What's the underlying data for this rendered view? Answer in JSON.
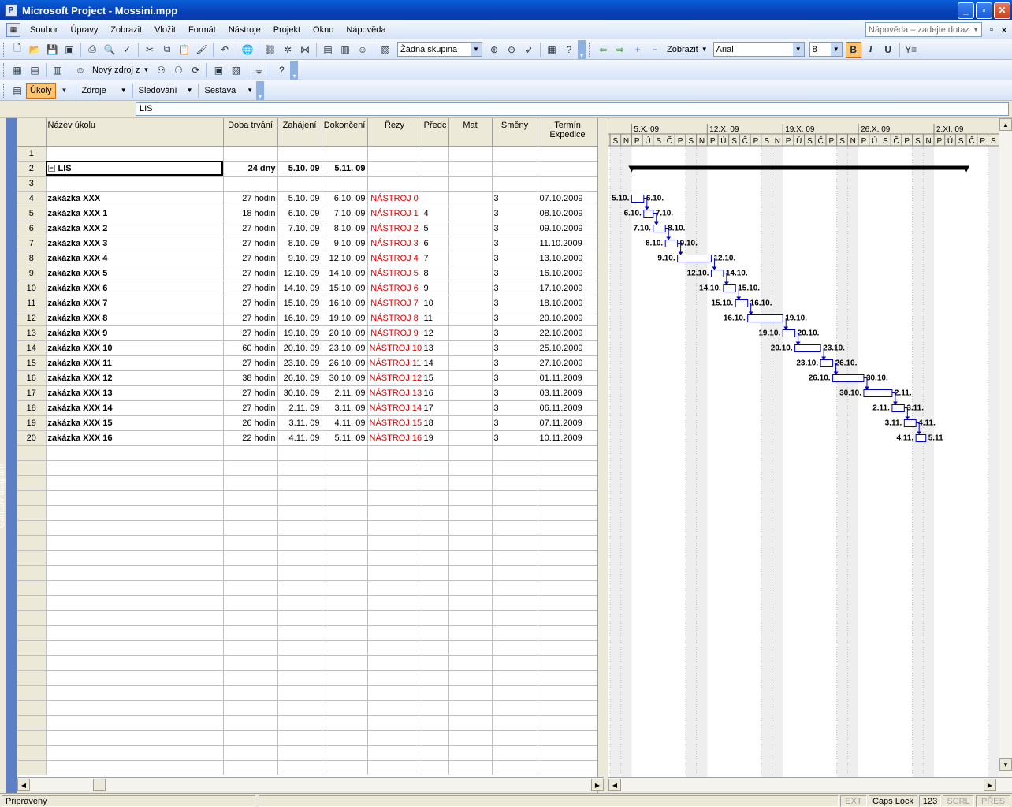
{
  "window": {
    "title": "Microsoft Project - Mossini.mpp",
    "app_icon": "ms-project-icon"
  },
  "menu": {
    "items": [
      "Soubor",
      "Úpravy",
      "Zobrazit",
      "Vložit",
      "Formát",
      "Nástroje",
      "Projekt",
      "Okno",
      "Nápověda"
    ],
    "help_placeholder": "Nápověda – zadejte dotaz"
  },
  "toolbar1": {
    "group_combo": "Žádná skupina",
    "show_label": "Zobrazit",
    "font_combo": "Arial",
    "size_combo": "8",
    "bold": "B",
    "italic": "I",
    "underline": "U"
  },
  "toolbar2": {
    "new_resource_label": "Nový zdroj z"
  },
  "toolbar3": {
    "items": [
      "Úkoly",
      "Zdroje",
      "Sledování",
      "Sestava"
    ],
    "active": "Úkoly"
  },
  "entry_bar": {
    "value": "LIS"
  },
  "side_label": "Ganttův diagram",
  "table": {
    "columns": [
      "Název úkolu",
      "Doba trvání",
      "Zahájení",
      "Dokončení",
      "Řezy",
      "Předc",
      "Mat",
      "Směny",
      "Termín Expedice"
    ],
    "rows": [
      {
        "id": "1",
        "name": "",
        "duration": "",
        "start": "",
        "finish": "",
        "rezy": "",
        "pred": "",
        "mat": "",
        "smeny": "",
        "termin": ""
      },
      {
        "id": "2",
        "name": "LIS",
        "duration": "24 dny",
        "start": "5.10. 09",
        "finish": "5.11. 09",
        "rezy": "",
        "pred": "",
        "mat": "",
        "smeny": "",
        "termin": ""
      },
      {
        "id": "3",
        "name": "",
        "duration": "",
        "start": "",
        "finish": "",
        "rezy": "",
        "pred": "",
        "mat": "",
        "smeny": "",
        "termin": ""
      },
      {
        "id": "4",
        "name": "zakázka XXX",
        "duration": "27 hodin",
        "start": "5.10. 09",
        "finish": "6.10. 09",
        "rezy": "NÁSTROJ 0",
        "pred": "",
        "mat": "",
        "smeny": "3",
        "termin": "07.10.2009"
      },
      {
        "id": "5",
        "name": "zakázka XXX 1",
        "duration": "18 hodin",
        "start": "6.10. 09",
        "finish": "7.10. 09",
        "rezy": "NÁSTROJ 1",
        "pred": "4",
        "mat": "",
        "smeny": "3",
        "termin": "08.10.2009"
      },
      {
        "id": "6",
        "name": "zakázka XXX 2",
        "duration": "27 hodin",
        "start": "7.10. 09",
        "finish": "8.10. 09",
        "rezy": "NÁSTROJ 2",
        "pred": "5",
        "mat": "",
        "smeny": "3",
        "termin": "09.10.2009"
      },
      {
        "id": "7",
        "name": "zakázka XXX 3",
        "duration": "27 hodin",
        "start": "8.10. 09",
        "finish": "9.10. 09",
        "rezy": "NÁSTROJ 3",
        "pred": "6",
        "mat": "",
        "smeny": "3",
        "termin": "11.10.2009"
      },
      {
        "id": "8",
        "name": "zakázka XXX 4",
        "duration": "27 hodin",
        "start": "9.10. 09",
        "finish": "12.10. 09",
        "rezy": "NÁSTROJ 4",
        "pred": "7",
        "mat": "",
        "smeny": "3",
        "termin": "13.10.2009"
      },
      {
        "id": "9",
        "name": "zakázka XXX 5",
        "duration": "27 hodin",
        "start": "12.10. 09",
        "finish": "14.10. 09",
        "rezy": "NÁSTROJ 5",
        "pred": "8",
        "mat": "",
        "smeny": "3",
        "termin": "16.10.2009"
      },
      {
        "id": "10",
        "name": "zakázka XXX 6",
        "duration": "27 hodin",
        "start": "14.10. 09",
        "finish": "15.10. 09",
        "rezy": "NÁSTROJ 6",
        "pred": "9",
        "mat": "",
        "smeny": "3",
        "termin": "17.10.2009"
      },
      {
        "id": "11",
        "name": "zakázka XXX 7",
        "duration": "27 hodin",
        "start": "15.10. 09",
        "finish": "16.10. 09",
        "rezy": "NÁSTROJ 7",
        "pred": "10",
        "mat": "",
        "smeny": "3",
        "termin": "18.10.2009"
      },
      {
        "id": "12",
        "name": "zakázka XXX 8",
        "duration": "27 hodin",
        "start": "16.10. 09",
        "finish": "19.10. 09",
        "rezy": "NÁSTROJ 8",
        "pred": "11",
        "mat": "",
        "smeny": "3",
        "termin": "20.10.2009"
      },
      {
        "id": "13",
        "name": "zakázka XXX 9",
        "duration": "27 hodin",
        "start": "19.10. 09",
        "finish": "20.10. 09",
        "rezy": "NÁSTROJ 9",
        "pred": "12",
        "mat": "",
        "smeny": "3",
        "termin": "22.10.2009"
      },
      {
        "id": "14",
        "name": "zakázka XXX 10",
        "duration": "60 hodin",
        "start": "20.10. 09",
        "finish": "23.10. 09",
        "rezy": "NÁSTROJ 10",
        "pred": "13",
        "mat": "",
        "smeny": "3",
        "termin": "25.10.2009"
      },
      {
        "id": "15",
        "name": "zakázka XXX 11",
        "duration": "27 hodin",
        "start": "23.10. 09",
        "finish": "26.10. 09",
        "rezy": "NÁSTROJ 11",
        "pred": "14",
        "mat": "",
        "smeny": "3",
        "termin": "27.10.2009"
      },
      {
        "id": "16",
        "name": "zakázka XXX 12",
        "duration": "38 hodin",
        "start": "26.10. 09",
        "finish": "30.10. 09",
        "rezy": "NÁSTROJ 12",
        "pred": "15",
        "mat": "",
        "smeny": "3",
        "termin": "01.11.2009"
      },
      {
        "id": "17",
        "name": "zakázka XXX 13",
        "duration": "27 hodin",
        "start": "30.10. 09",
        "finish": "2.11. 09",
        "rezy": "NÁSTROJ 13",
        "pred": "16",
        "mat": "",
        "smeny": "3",
        "termin": "03.11.2009"
      },
      {
        "id": "18",
        "name": "zakázka XXX 14",
        "duration": "27 hodin",
        "start": "2.11. 09",
        "finish": "3.11. 09",
        "rezy": "NÁSTROJ 14",
        "pred": "17",
        "mat": "",
        "smeny": "3",
        "termin": "06.11.2009"
      },
      {
        "id": "19",
        "name": "zakázka XXX 15",
        "duration": "26 hodin",
        "start": "3.11. 09",
        "finish": "4.11. 09",
        "rezy": "NÁSTROJ 15",
        "pred": "18",
        "mat": "",
        "smeny": "3",
        "termin": "07.11.2009"
      },
      {
        "id": "20",
        "name": "zakázka XXX 16",
        "duration": "22 hodin",
        "start": "4.11. 09",
        "finish": "5.11. 09",
        "rezy": "NÁSTROJ 16",
        "pred": "19",
        "mat": "",
        "smeny": "3",
        "termin": "10.11.2009"
      }
    ]
  },
  "gantt": {
    "weeks": [
      "5.X. 09",
      "12.X. 09",
      "19.X. 09",
      "26.X. 09",
      "2.XI. 09"
    ],
    "day_letters": [
      "S",
      "N",
      "P",
      "Ú",
      "S",
      "Č",
      "P",
      "S",
      "N",
      "P",
      "Ú",
      "S",
      "Č",
      "P",
      "S",
      "N",
      "P",
      "Ú",
      "S",
      "Č",
      "P",
      "S",
      "N",
      "P",
      "Ú",
      "S",
      "Č",
      "P",
      "S",
      "N",
      "P",
      "Ú",
      "S",
      "Č",
      "P",
      "S"
    ],
    "timeline_start": "2009-10-03",
    "summary": {
      "start": "2009-10-05",
      "finish": "2009-11-05"
    },
    "tasks": [
      {
        "row": "4",
        "start": "2009-10-05T00:00",
        "finish": "2009-10-06T03:00",
        "start_label": "5.10.",
        "finish_label": "6.10."
      },
      {
        "row": "5",
        "start": "2009-10-06T03:00",
        "finish": "2009-10-07T00:00",
        "start_label": "6.10.",
        "finish_label": "7.10."
      },
      {
        "row": "6",
        "start": "2009-10-07T00:00",
        "finish": "2009-10-08T03:00",
        "start_label": "7.10.",
        "finish_label": "8.10."
      },
      {
        "row": "7",
        "start": "2009-10-08T03:00",
        "finish": "2009-10-09T06:00",
        "start_label": "8.10.",
        "finish_label": "9.10."
      },
      {
        "row": "8",
        "start": "2009-10-09T06:00",
        "finish": "2009-10-12T09:00",
        "start_label": "9.10.",
        "finish_label": "12.10."
      },
      {
        "row": "9",
        "start": "2009-10-12T09:00",
        "finish": "2009-10-13T12:00",
        "start_label": "12.10.",
        "finish_label": "14.10."
      },
      {
        "row": "10",
        "start": "2009-10-13T12:00",
        "finish": "2009-10-14T15:00",
        "start_label": "14.10.",
        "finish_label": "15.10."
      },
      {
        "row": "11",
        "start": "2009-10-14T15:00",
        "finish": "2009-10-15T18:00",
        "start_label": "15.10.",
        "finish_label": "16.10."
      },
      {
        "row": "12",
        "start": "2009-10-15T18:00",
        "finish": "2009-10-19T00:00",
        "start_label": "16.10.",
        "finish_label": "19.10."
      },
      {
        "row": "13",
        "start": "2009-10-19T00:00",
        "finish": "2009-10-20T03:00",
        "start_label": "19.10.",
        "finish_label": "20.10."
      },
      {
        "row": "14",
        "start": "2009-10-20T03:00",
        "finish": "2009-10-22T12:00",
        "start_label": "20.10.",
        "finish_label": "23.10."
      },
      {
        "row": "15",
        "start": "2009-10-22T12:00",
        "finish": "2009-10-23T15:00",
        "start_label": "23.10.",
        "finish_label": "26.10."
      },
      {
        "row": "16",
        "start": "2009-10-23T15:00",
        "finish": "2009-10-26T12:00",
        "start_label": "26.10.",
        "finish_label": "30.10."
      },
      {
        "row": "17",
        "start": "2009-10-26T12:00",
        "finish": "2009-10-29T03:00",
        "start_label": "30.10.",
        "finish_label": "2.11."
      },
      {
        "row": "18",
        "start": "2009-10-29T03:00",
        "finish": "2009-10-30T06:00",
        "start_label": "2.11.",
        "finish_label": "3.11."
      },
      {
        "row": "19",
        "start": "2009-10-30T06:00",
        "finish": "2009-10-31T08:00",
        "start_label": "3.11.",
        "finish_label": "4.11."
      },
      {
        "row": "20",
        "start": "2009-10-31T08:00",
        "finish": "2009-11-01T06:00",
        "start_label": "4.11.",
        "finish_label": "5.11"
      }
    ]
  },
  "status": {
    "ready": "Připravený",
    "indicators": [
      "EXT",
      "Caps Lock",
      "123",
      "SCRL",
      "PŘES"
    ],
    "active_indicators": [
      "Caps Lock",
      "123"
    ]
  },
  "colors": {
    "titlebar": "#0a4ad0",
    "bar_outline": "#0000c0",
    "link_arrow": "#0000c0",
    "red_text": "#e00000"
  }
}
